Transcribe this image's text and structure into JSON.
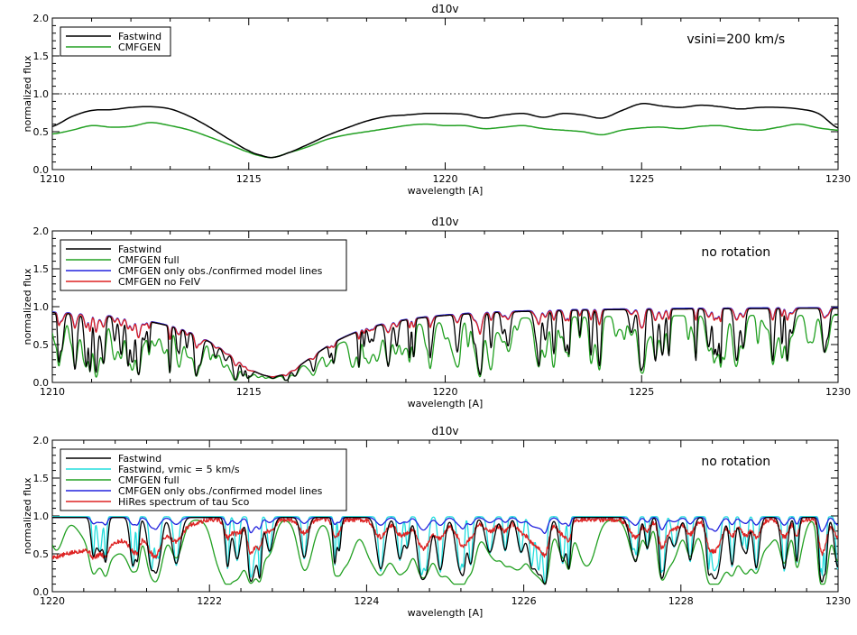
{
  "figure": {
    "panel_count": 3
  },
  "chart_data": [
    {
      "type": "line",
      "title": "d10v",
      "xlabel": "wavelength [A]",
      "ylabel": "normalized flux",
      "xlim": [
        1210,
        1230
      ],
      "ylim": [
        0.0,
        2.0
      ],
      "xticks": [
        1210,
        1215,
        1220,
        1225,
        1230
      ],
      "yticks": [
        "0.0",
        "0.5",
        "1.0",
        "1.5",
        "2.0"
      ],
      "annotation": "vsini=200 km/s",
      "reference_line": {
        "y": 1.0,
        "style": "dotted"
      },
      "legend_position": "top-left",
      "series": [
        {
          "name": "Fastwind",
          "color": "#000000",
          "x": [
            1210,
            1210.5,
            1211,
            1211.5,
            1212,
            1212.5,
            1213,
            1213.5,
            1214,
            1214.5,
            1215,
            1215.3,
            1215.6,
            1216,
            1216.5,
            1217,
            1217.5,
            1218,
            1218.5,
            1219,
            1219.5,
            1220,
            1220.5,
            1221,
            1221.5,
            1222,
            1222.5,
            1223,
            1223.5,
            1224,
            1224.5,
            1225,
            1225.5,
            1226,
            1226.5,
            1227,
            1227.5,
            1228,
            1228.5,
            1229,
            1229.5,
            1230
          ],
          "y": [
            0.57,
            0.7,
            0.78,
            0.79,
            0.82,
            0.83,
            0.8,
            0.7,
            0.56,
            0.4,
            0.25,
            0.19,
            0.16,
            0.22,
            0.33,
            0.45,
            0.55,
            0.64,
            0.7,
            0.72,
            0.74,
            0.74,
            0.73,
            0.68,
            0.72,
            0.74,
            0.69,
            0.74,
            0.72,
            0.68,
            0.78,
            0.87,
            0.84,
            0.82,
            0.85,
            0.83,
            0.8,
            0.82,
            0.82,
            0.8,
            0.74,
            0.55
          ]
        },
        {
          "name": "CMFGEN",
          "color": "#22a022",
          "x": [
            1210,
            1210.5,
            1211,
            1211.5,
            1212,
            1212.5,
            1213,
            1213.5,
            1214,
            1214.5,
            1215,
            1215.3,
            1215.6,
            1216,
            1216.5,
            1217,
            1217.5,
            1218,
            1218.5,
            1219,
            1219.5,
            1220,
            1220.5,
            1221,
            1221.5,
            1222,
            1222.5,
            1223,
            1223.5,
            1224,
            1224.5,
            1225,
            1225.5,
            1226,
            1226.5,
            1227,
            1227.5,
            1228,
            1228.5,
            1229,
            1229.5,
            1230
          ],
          "y": [
            0.47,
            0.52,
            0.58,
            0.56,
            0.57,
            0.62,
            0.58,
            0.52,
            0.43,
            0.33,
            0.23,
            0.18,
            0.16,
            0.22,
            0.3,
            0.4,
            0.46,
            0.5,
            0.54,
            0.58,
            0.6,
            0.58,
            0.58,
            0.54,
            0.56,
            0.58,
            0.54,
            0.52,
            0.5,
            0.46,
            0.52,
            0.55,
            0.56,
            0.54,
            0.57,
            0.58,
            0.54,
            0.52,
            0.56,
            0.6,
            0.55,
            0.52
          ]
        }
      ]
    },
    {
      "type": "line",
      "title": "d10v",
      "xlabel": "wavelength [A]",
      "ylabel": "normalized flux",
      "xlim": [
        1210,
        1230
      ],
      "ylim": [
        0.0,
        2.0
      ],
      "xticks": [
        1210,
        1215,
        1220,
        1225,
        1230
      ],
      "yticks": [
        "0.0",
        "0.5",
        "1.0",
        "1.5",
        "2.0"
      ],
      "annotation": "no rotation",
      "legend_position": "top-left",
      "series": [
        {
          "name": "Fastwind",
          "color": "#000000"
        },
        {
          "name": "CMFGEN full",
          "color": "#22a022"
        },
        {
          "name": "CMFGEN only obs./confirmed model lines",
          "color": "#2222dd"
        },
        {
          "name": "CMFGEN no FeIV",
          "color": "#dd2222"
        }
      ]
    },
    {
      "type": "line",
      "title": "d10v",
      "xlabel": "wavelength [A]",
      "ylabel": "normalized flux",
      "xlim": [
        1220,
        1230
      ],
      "ylim": [
        0.0,
        2.0
      ],
      "xticks": [
        1220,
        1222,
        1224,
        1226,
        1228,
        1230
      ],
      "yticks": [
        "0.0",
        "0.5",
        "1.0",
        "1.5",
        "2.0"
      ],
      "annotation": "no rotation",
      "legend_position": "top-left",
      "series": [
        {
          "name": "Fastwind",
          "color": "#000000"
        },
        {
          "name": "Fastwind, vmic = 5 km/s",
          "color": "#22dddd"
        },
        {
          "name": "CMFGEN full",
          "color": "#22a022"
        },
        {
          "name": "CMFGEN only obs./confirmed model lines",
          "color": "#2222dd"
        },
        {
          "name": "HiRes spectrum of tau Sco",
          "color": "#dd2222"
        }
      ]
    }
  ]
}
